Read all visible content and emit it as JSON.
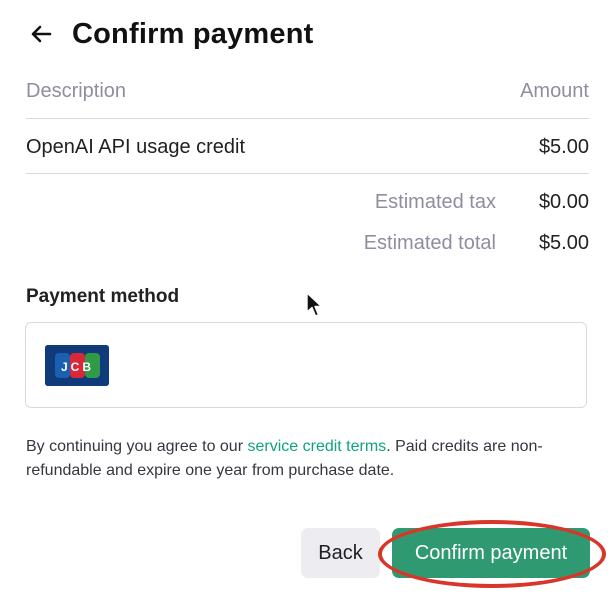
{
  "header": {
    "title": "Confirm payment",
    "back_icon": "arrow-left-icon"
  },
  "summary": {
    "col_description": "Description",
    "col_amount": "Amount",
    "items": [
      {
        "description": "OpenAI API usage credit",
        "amount": "$5.00"
      }
    ],
    "tax_label": "Estimated tax",
    "tax_value": "$0.00",
    "total_label": "Estimated total",
    "total_value": "$5.00"
  },
  "payment": {
    "label": "Payment method",
    "card_brand": "JCB"
  },
  "legal": {
    "before": "By continuing you agree to our ",
    "link": "service credit terms",
    "after": ". Paid credits are non-refundable and expire one year from purchase date."
  },
  "actions": {
    "back_label": "Back",
    "confirm_label": "Confirm payment"
  },
  "colors": {
    "accent": "#2f9a72",
    "link": "#10a37f",
    "annotation": "#d9362a",
    "card": "#0f3b7a"
  }
}
